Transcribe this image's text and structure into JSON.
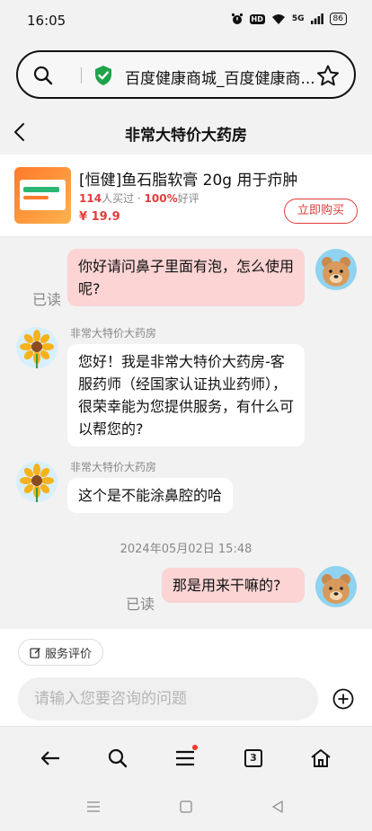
{
  "status_bar": {
    "time": "16:05",
    "hd": "HD",
    "network": "5G",
    "battery": "86"
  },
  "address_bar": {
    "url_title": "百度健康商城_百度健康商..."
  },
  "chat": {
    "title": "非常大特价大药房"
  },
  "product": {
    "name": "[恒健]鱼石脂软膏 20g 用于疖肿",
    "buyers_count": "114",
    "buyers_suffix": "人买过 · ",
    "rating": "100%",
    "rating_suffix": "好评",
    "price": "¥ 19.9",
    "buy_label": "立即购买"
  },
  "messages": {
    "m1": {
      "text": "你好请问鼻子里面有泡，怎么使用呢?",
      "read": "已读"
    },
    "m2": {
      "sender": "非常大特价大药房",
      "text": "您好！我是非常大特价大药房-客服药师（经国家认证执业药师），很荣幸能为您提供服务，有什么可以帮您的?"
    },
    "m3": {
      "sender": "非常大特价大药房",
      "text": "这个是不能涂鼻腔的哈"
    },
    "timestamp": "2024年05月02日 15:48",
    "m4": {
      "text": "那是用来干嘛的?",
      "read": "已读"
    }
  },
  "service_rating_label": "服务评价",
  "composer": {
    "placeholder": "请输入您要咨询的问题"
  },
  "toolbar": {
    "tab_count": "3"
  },
  "colors": {
    "accent_red": "#e23b3b",
    "my_bubble": "#fcd4d4",
    "shield_green": "#1fa34a"
  }
}
